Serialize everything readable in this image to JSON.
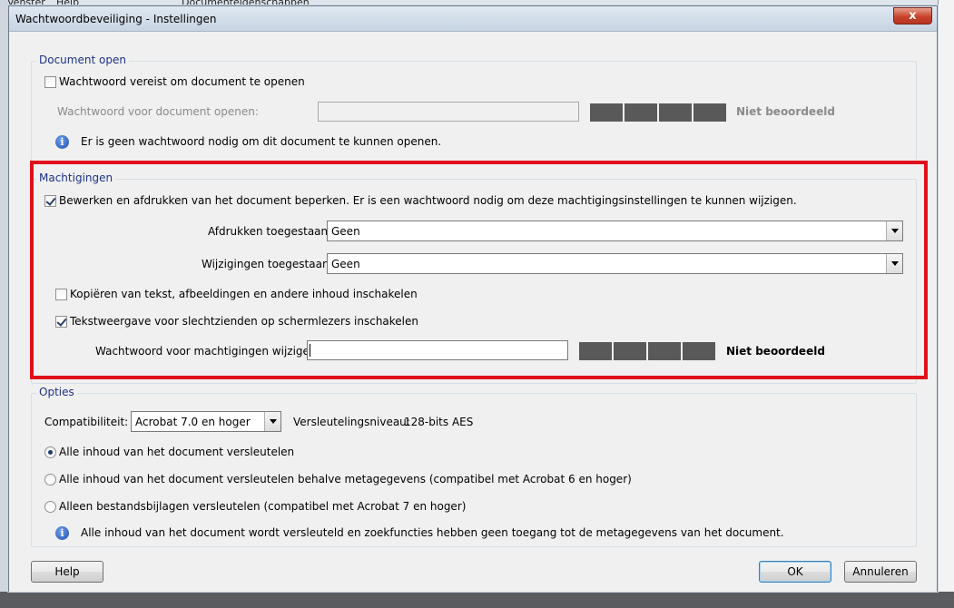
{
  "background": {
    "menu_venster": "Venster",
    "menu_help": "Help",
    "behind_title": "Documenteigenschappen"
  },
  "dialog": {
    "title": "Wachtwoordbeveiliging - Instellingen",
    "close_label": "x"
  },
  "document_open": {
    "group_title": "Document open",
    "require_password_label": "Wachtwoord vereist om document te openen",
    "require_password_checked": false,
    "password_field_label": "Wachtwoord voor document openen:",
    "password_value": "",
    "strength_label": "Niet beoordeeld",
    "info_text": "Er is geen wachtwoord nodig om dit document te kunnen openen."
  },
  "permissions": {
    "group_title": "Machtigingen",
    "restrict_label": "Bewerken en afdrukken van het document beperken. Er is een wachtwoord nodig om deze machtigingsinstellingen te kunnen wijzigen.",
    "restrict_checked": true,
    "printing_label": "Afdrukken toegestaan:",
    "printing_value": "Geen",
    "changes_label": "Wijzigingen toegestaan:",
    "changes_value": "Geen",
    "copy_label": "Kopiëren van tekst, afbeeldingen en andere inhoud inschakelen",
    "copy_checked": false,
    "screenreader_label": "Tekstweergave voor slechtzienden op schermlezers inschakelen",
    "screenreader_checked": true,
    "change_password_label": "Wachtwoord voor machtigingen wijzigen:",
    "change_password_value": "",
    "strength_label": "Niet beoordeeld",
    "highlight_color": "#e0101a"
  },
  "options": {
    "group_title": "Opties",
    "compat_label": "Compatibiliteit:",
    "compat_value": "Acrobat 7.0 en hoger",
    "encryption_label": "Versleutelingsniveau:",
    "encryption_value": "128-bits AES",
    "radio_all": "Alle inhoud van het document versleutelen",
    "radio_all_but_meta": "Alle inhoud van het document versleutelen behalve metagegevens (compatibel met Acrobat 6 en hoger)",
    "radio_attachments": "Alleen bestandsbijlagen versleutelen (compatibel met Acrobat 7 en hoger)",
    "selected_radio": "radio_all",
    "info_text": "Alle inhoud van het document wordt versleuteld en zoekfuncties hebben geen toegang tot de metagegevens van het document."
  },
  "buttons": {
    "help": "Help",
    "ok": "OK",
    "cancel": "Annuleren"
  },
  "icons": {
    "info": "info-icon",
    "close": "close-icon",
    "dropdown": "chevron-down-icon"
  }
}
